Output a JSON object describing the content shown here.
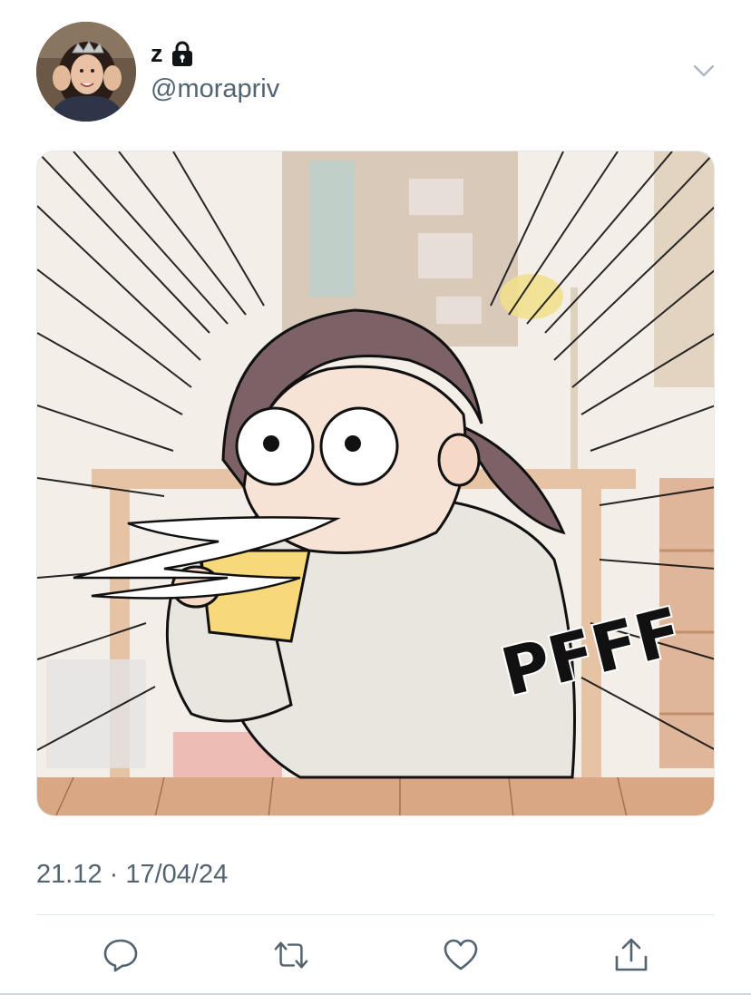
{
  "user": {
    "display_name": "z",
    "handle": "@morapriv",
    "protected": true
  },
  "media": {
    "sound_effect": "PFFF"
  },
  "tweet": {
    "timestamp": "21.12 · 17/04/24"
  },
  "actions": {
    "icons": [
      "reply-icon",
      "retweet-icon",
      "like-icon",
      "share-icon"
    ]
  },
  "colors": {
    "text_primary": "#0f1419",
    "text_secondary": "#536471",
    "icon": "#536471",
    "border": "#e1e8ed"
  }
}
